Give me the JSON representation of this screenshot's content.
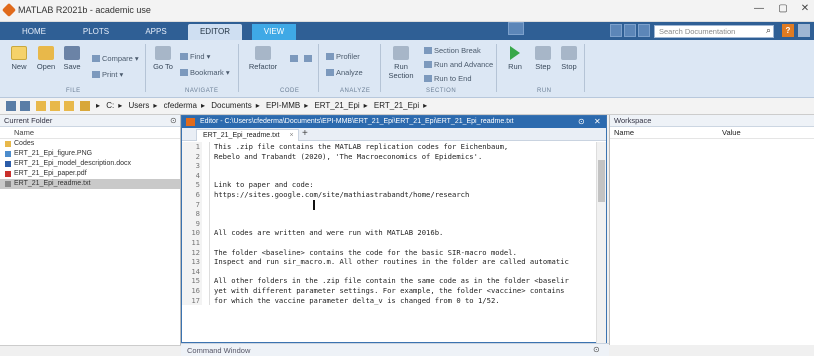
{
  "window": {
    "title": "MATLAB R2021b - academic use",
    "min_glyph": "—",
    "max_glyph": "▢",
    "close_glyph": "✕"
  },
  "tabs": [
    {
      "label": "HOME"
    },
    {
      "label": "PLOTS"
    },
    {
      "label": "APPS"
    },
    {
      "label": "EDITOR"
    },
    {
      "label": "VIEW"
    }
  ],
  "search": {
    "placeholder": "Search Documentation"
  },
  "help_label": "?",
  "ribbon": {
    "file": {
      "new": "New",
      "open": "Open",
      "save": "Save",
      "compare": "Compare ▾",
      "print": "Print ▾",
      "section_label": "FILE"
    },
    "navigate": {
      "go_to": "Go To",
      "find": "Find ▾",
      "bookmark": "Bookmark ▾",
      "section_label": "NAVIGATE"
    },
    "code": {
      "refactor": "Refactor",
      "section_label": "CODE"
    },
    "analyze": {
      "profiler": "Profiler",
      "analyze": "Analyze",
      "section_label": "ANALYZE"
    },
    "section": {
      "run_section": "Run Section",
      "section_break": "Section Break",
      "run_advance": "Run and Advance",
      "run_to_end": "Run to End",
      "section_label": "SECTION"
    },
    "run": {
      "run": "Run",
      "step": "Step",
      "stop": "Stop",
      "section_label": "RUN"
    }
  },
  "address": {
    "path": [
      "C:",
      "Users",
      "cfederma",
      "Documents",
      "EPI-MMB",
      "ERT_21_Epi",
      "ERT_21_Epi"
    ]
  },
  "current_folder": {
    "title": "Current Folder",
    "col_name": "Name",
    "items": [
      {
        "label": "Codes",
        "kind": "folder",
        "selected": false
      },
      {
        "label": "ERT_21_Epi_figure.PNG",
        "kind": "image",
        "selected": false
      },
      {
        "label": "ERT_21_Epi_model_description.docx",
        "kind": "doc",
        "selected": false
      },
      {
        "label": "ERT_21_Epi_paper.pdf",
        "kind": "pdf",
        "selected": false
      },
      {
        "label": "ERT_21_Epi_readme.txt",
        "kind": "txt",
        "selected": true
      }
    ]
  },
  "editor": {
    "title": "Editor - C:\\Users\\cfederma\\Documents\\EPI-MMB\\ERT_21_Epi\\ERT_21_Epi\\ERT_21_Epi_readme.txt",
    "tab": "ERT_21_Epi_readme.txt",
    "plus": "+",
    "lines": [
      {
        "n": "1",
        "text": "This .zip file contains the MATLAB replication codes for Eichenbaum,"
      },
      {
        "n": "2",
        "text": "Rebelo and Trabandt (2020), 'The Macroeconomics of Epidemics'."
      },
      {
        "n": "3",
        "text": ""
      },
      {
        "n": "4",
        "text": ""
      },
      {
        "n": "5",
        "text": "Link to paper and code:"
      },
      {
        "n": "6",
        "text": "https://sites.google.com/site/mathiastrabandt/home/research"
      },
      {
        "n": "7",
        "text": ""
      },
      {
        "n": "8",
        "text": ""
      },
      {
        "n": "9",
        "text": ""
      },
      {
        "n": "10",
        "text": "All codes are written and were run with MATLAB 2016b."
      },
      {
        "n": "11",
        "text": ""
      },
      {
        "n": "12",
        "text": "The folder <baseline> contains the code for the basic SIR-macro model."
      },
      {
        "n": "13",
        "text": "Inspect and run sir_macro.m. All other routines in the folder are called automatic"
      },
      {
        "n": "14",
        "text": ""
      },
      {
        "n": "15",
        "text": "All other folders in the .zip file contain the same code as in the folder <baselir"
      },
      {
        "n": "16",
        "text": "yet with different parameter settings. For example, the folder <vaccine> contains"
      },
      {
        "n": "17",
        "text": "for which the vaccine parameter delta_v is changed from 0 to 1/52."
      }
    ]
  },
  "workspace": {
    "title": "Workspace",
    "col_name": "Name",
    "col_value": "Value"
  },
  "command_window": {
    "title": "Command Window"
  }
}
